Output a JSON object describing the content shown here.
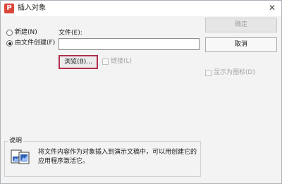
{
  "window": {
    "title": "插入对象",
    "app_icon": "wps-presentation-icon",
    "close_glyph": "✕"
  },
  "source_options": [
    {
      "label": "新建(N)",
      "selected": false
    },
    {
      "label": "由文件创建(F)",
      "selected": true
    }
  ],
  "file": {
    "label": "文件(E):",
    "value": ""
  },
  "buttons": {
    "ok": "确定",
    "cancel": "取消",
    "browse": "浏览(B)..."
  },
  "link_checkbox": {
    "label": "链接(L)",
    "checked": false,
    "enabled": false
  },
  "display_as_icon": {
    "label": "显示为图标(D)",
    "checked": false,
    "enabled": false
  },
  "result": {
    "title": "说明",
    "icon": "document-insert-icon",
    "text": "将文件内容作为对象插入到演示文稿中，可以用创建它的应用程序激活它。"
  }
}
